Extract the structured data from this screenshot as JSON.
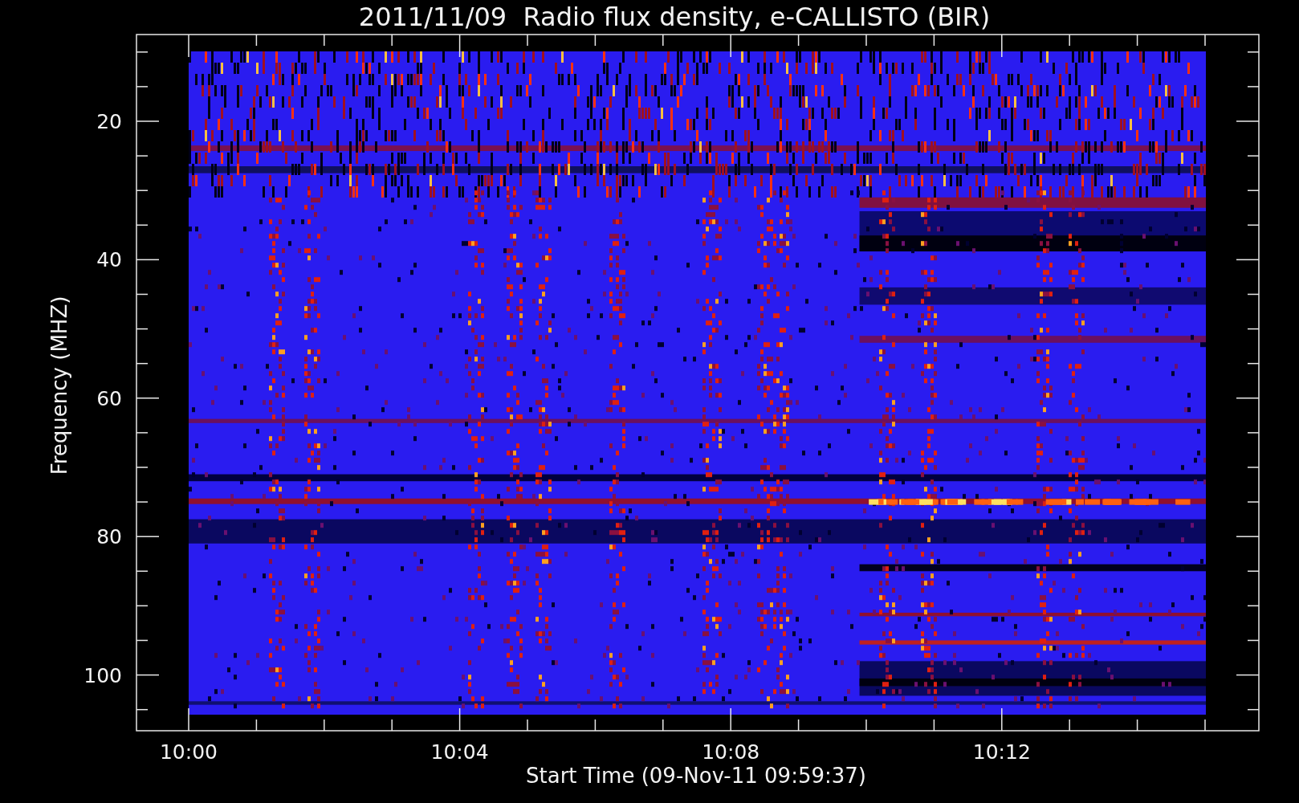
{
  "title": "2011/11/09  Radio flux density, e-CALLISTO (BIR)",
  "y_axis": {
    "label": "Frequency (MHZ)",
    "ticks": [
      "20",
      "40",
      "60",
      "80",
      "100"
    ]
  },
  "x_axis": {
    "label": "Start Time (09-Nov-11 09:59:37)",
    "ticks": [
      "10:00",
      "10:04",
      "10:08",
      "10:12"
    ]
  }
}
